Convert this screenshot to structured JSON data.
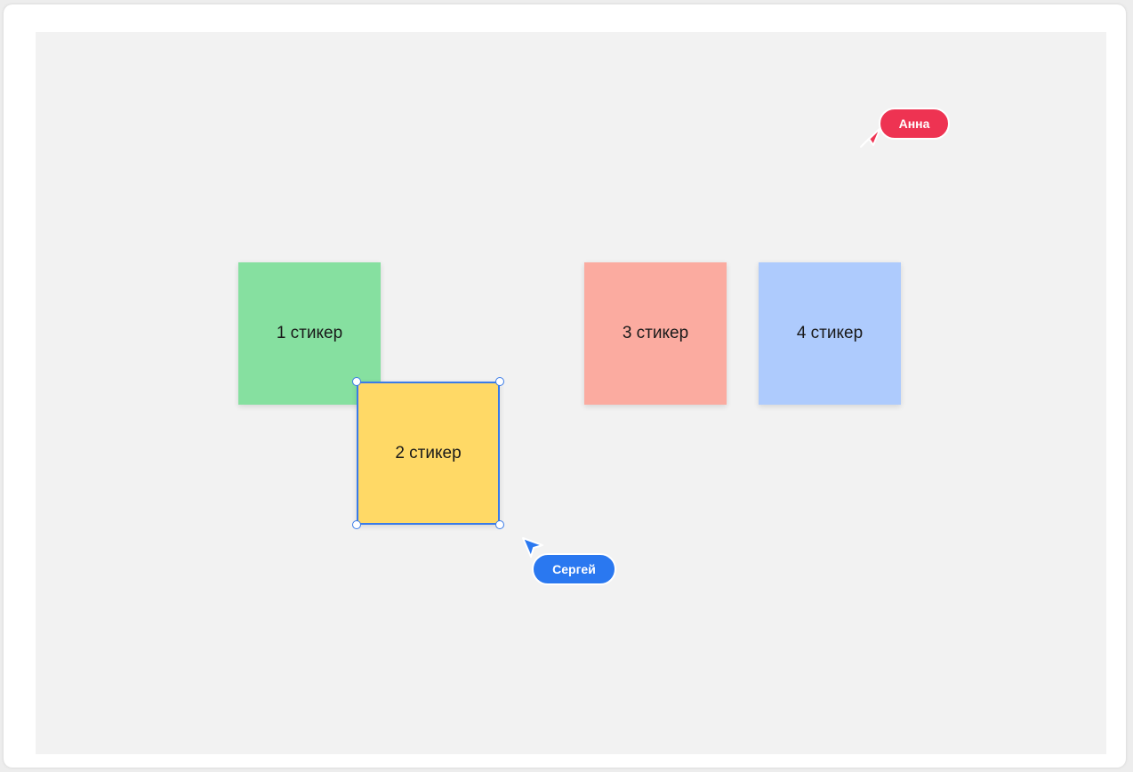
{
  "board": {
    "stickers": [
      {
        "label": "1 стикер",
        "color": "#86e0a0"
      },
      {
        "label": "2 стикер",
        "color": "#ffd966",
        "selected": true
      },
      {
        "label": "3 стикер",
        "color": "#fbaba0"
      },
      {
        "label": "4 стикер",
        "color": "#aecbfd"
      }
    ],
    "selection_color": "#3a7be8"
  },
  "cursors": [
    {
      "name": "Анна",
      "color": "#ee3352"
    },
    {
      "name": "Сергей",
      "color": "#2a78f0"
    }
  ]
}
